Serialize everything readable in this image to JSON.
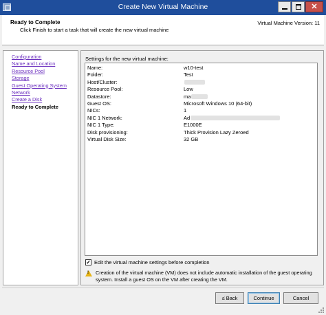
{
  "window": {
    "title": "Create New Virtual Machine",
    "minimize_icon": "minimize-icon",
    "maximize_icon": "maximize-icon",
    "close_glyph": "✕"
  },
  "header": {
    "title": "Ready to Complete",
    "subtitle": "Click Finish to start a task that will create the new virtual machine",
    "version": "Virtual Machine Version: 11"
  },
  "nav": {
    "items": [
      {
        "label": "Configuration"
      },
      {
        "label": "Name and Location"
      },
      {
        "label": "Resource Pool"
      },
      {
        "label": "Storage"
      },
      {
        "label": "Guest Operating System"
      },
      {
        "label": "Network"
      },
      {
        "label": "Create a Disk"
      },
      {
        "label": "Ready to Complete"
      }
    ],
    "current_index": 7
  },
  "settings": {
    "title": "Settings for the new virtual machine:",
    "rows": [
      {
        "key": "Name:",
        "value": "w10-test"
      },
      {
        "key": "Folder:",
        "value": "Test"
      },
      {
        "key": "Host/Cluster:",
        "value": ""
      },
      {
        "key": "Resource Pool:",
        "value": "Low"
      },
      {
        "key": "Datastore:",
        "value": "ma"
      },
      {
        "key": "Guest OS:",
        "value": "Microsoft Windows 10 (64-bit)"
      },
      {
        "key": "NICs:",
        "value": "1"
      },
      {
        "key": "NIC 1 Network:",
        "value": "Ad"
      },
      {
        "key": "NIC 1 Type:",
        "value": "E1000E"
      },
      {
        "key": "Disk provisioning:",
        "value": "Thick Provision Lazy Zeroed"
      },
      {
        "key": "Virtual Disk Size:",
        "value": "32 GB"
      }
    ]
  },
  "options": {
    "edit_before_completion_label": "Edit the virtual machine settings before completion",
    "edit_before_completion_checked": true,
    "check_glyph": "✓"
  },
  "warning": {
    "icon": "warning-icon",
    "text": "Creation of the virtual machine (VM) does not include automatic installation of the guest operating system. Install a guest OS on the VM after creating the VM."
  },
  "buttons": {
    "back": "≤ Back",
    "continue": "Continue",
    "cancel": "Cancel"
  },
  "colors": {
    "titlebar": "#1f4e9c",
    "link": "#6b2fbf",
    "close": "#c7504a"
  }
}
